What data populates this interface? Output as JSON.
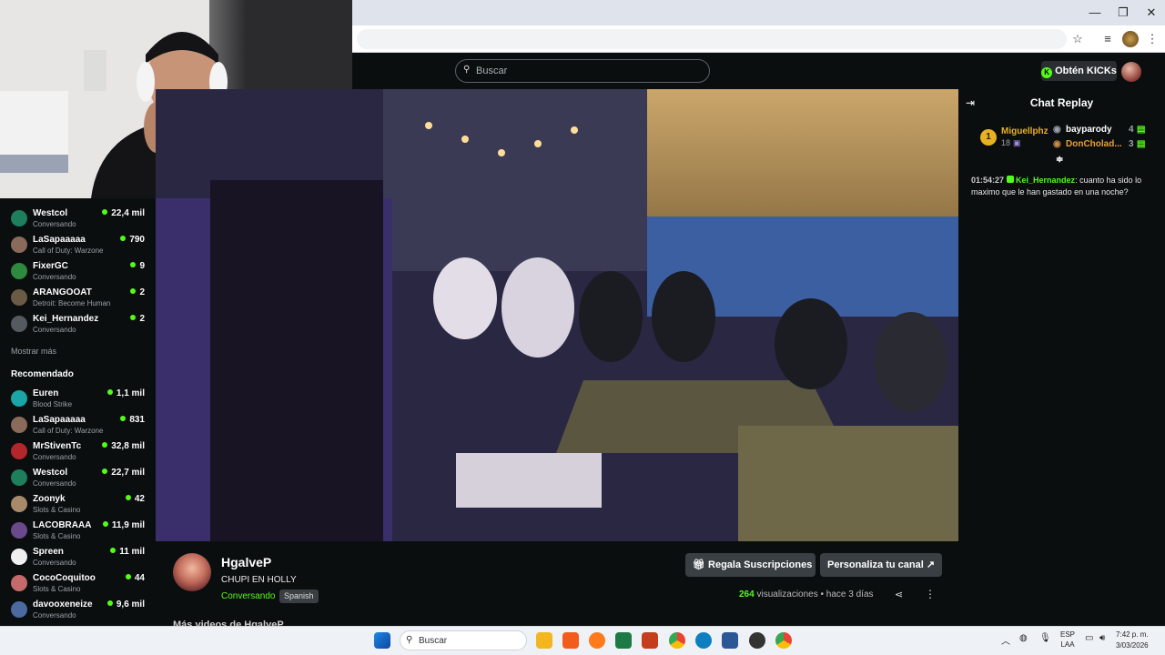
{
  "browser": {
    "window_controls": [
      "—",
      "❐",
      "✕"
    ],
    "toolbar_icons": [
      "star-icon",
      "media-icon",
      "profile-icon",
      "menu-icon"
    ]
  },
  "header": {
    "search_placeholder": "Buscar",
    "kicks_label": "Obtén KICKs"
  },
  "sidebar": {
    "following": [
      {
        "name": "Westcol",
        "game": "Conversando",
        "viewers": "22,4 mil",
        "avatar_color": "#1e7f5c"
      },
      {
        "name": "LaSapaaaaa",
        "game": "Call of Duty: Warzone",
        "viewers": "790",
        "avatar_color": "#8a6a5a"
      },
      {
        "name": "FixerGC",
        "game": "Conversando",
        "viewers": "9",
        "avatar_color": "#2d8a3e"
      },
      {
        "name": "ARANGOOAT",
        "game": "Detroit: Become Human",
        "viewers": "2",
        "avatar_color": "#6b5a45"
      },
      {
        "name": "Kei_Hernandez",
        "game": "Conversando",
        "viewers": "2",
        "avatar_color": "#555a60"
      }
    ],
    "show_more": "Mostrar más",
    "recommended_heading": "Recomendado",
    "recommended": [
      {
        "name": "Euren",
        "game": "Blood Strike",
        "viewers": "1,1 mil",
        "avatar_color": "#1aa6a6"
      },
      {
        "name": "LaSapaaaaa",
        "game": "Call of Duty: Warzone",
        "viewers": "831",
        "avatar_color": "#8a6a5a"
      },
      {
        "name": "MrStivenTc",
        "game": "Conversando",
        "viewers": "32,8 mil",
        "avatar_color": "#b3262b"
      },
      {
        "name": "Westcol",
        "game": "Conversando",
        "viewers": "22,7 mil",
        "avatar_color": "#1e7f5c"
      },
      {
        "name": "Zoonyk",
        "game": "Slots & Casino",
        "viewers": "42",
        "avatar_color": "#a88a6a"
      },
      {
        "name": "LACOBRAAA",
        "game": "Slots & Casino",
        "viewers": "11,9 mil",
        "avatar_color": "#6a4a8a"
      },
      {
        "name": "Spreen",
        "game": "Conversando",
        "viewers": "11 mil",
        "avatar_color": "#f0f0f0"
      },
      {
        "name": "CocoCoquitoo",
        "game": "Slots & Casino",
        "viewers": "44",
        "avatar_color": "#c46a6a"
      },
      {
        "name": "davooxeneize",
        "game": "Conversando",
        "viewers": "9,6 mil",
        "avatar_color": "#4a6aa0"
      }
    ]
  },
  "chat": {
    "title": "Chat Replay",
    "leaderboard": {
      "top_rank": "1",
      "top_name": "Miguellphz",
      "top_count": "18",
      "entries": [
        {
          "name": "bayparody",
          "count": "4"
        },
        {
          "name": "DonCholad...",
          "count": "3"
        }
      ]
    },
    "messages": [
      {
        "time": "01:54:27",
        "user": "Kei_Hernandez",
        "text": "cuanto ha sido lo maximo que le han gastado en una noche?"
      }
    ]
  },
  "channel": {
    "name": "HgalveP",
    "stream_title": "CHUPI EN HOLLY",
    "category": "Conversando",
    "language": "Spanish",
    "gift_button": "Regala Suscripciones",
    "customize_button": "Personaliza tu canal",
    "views_count": "264",
    "views_label": "visualizaciones",
    "time_ago": "hace 3 días",
    "more_videos": "Más videos de HgalveP"
  },
  "taskbar": {
    "search_placeholder": "Buscar",
    "lang_line1": "ESP",
    "lang_line2": "LAA",
    "time": "7:42 p. m.",
    "date": "3/03/2026"
  }
}
